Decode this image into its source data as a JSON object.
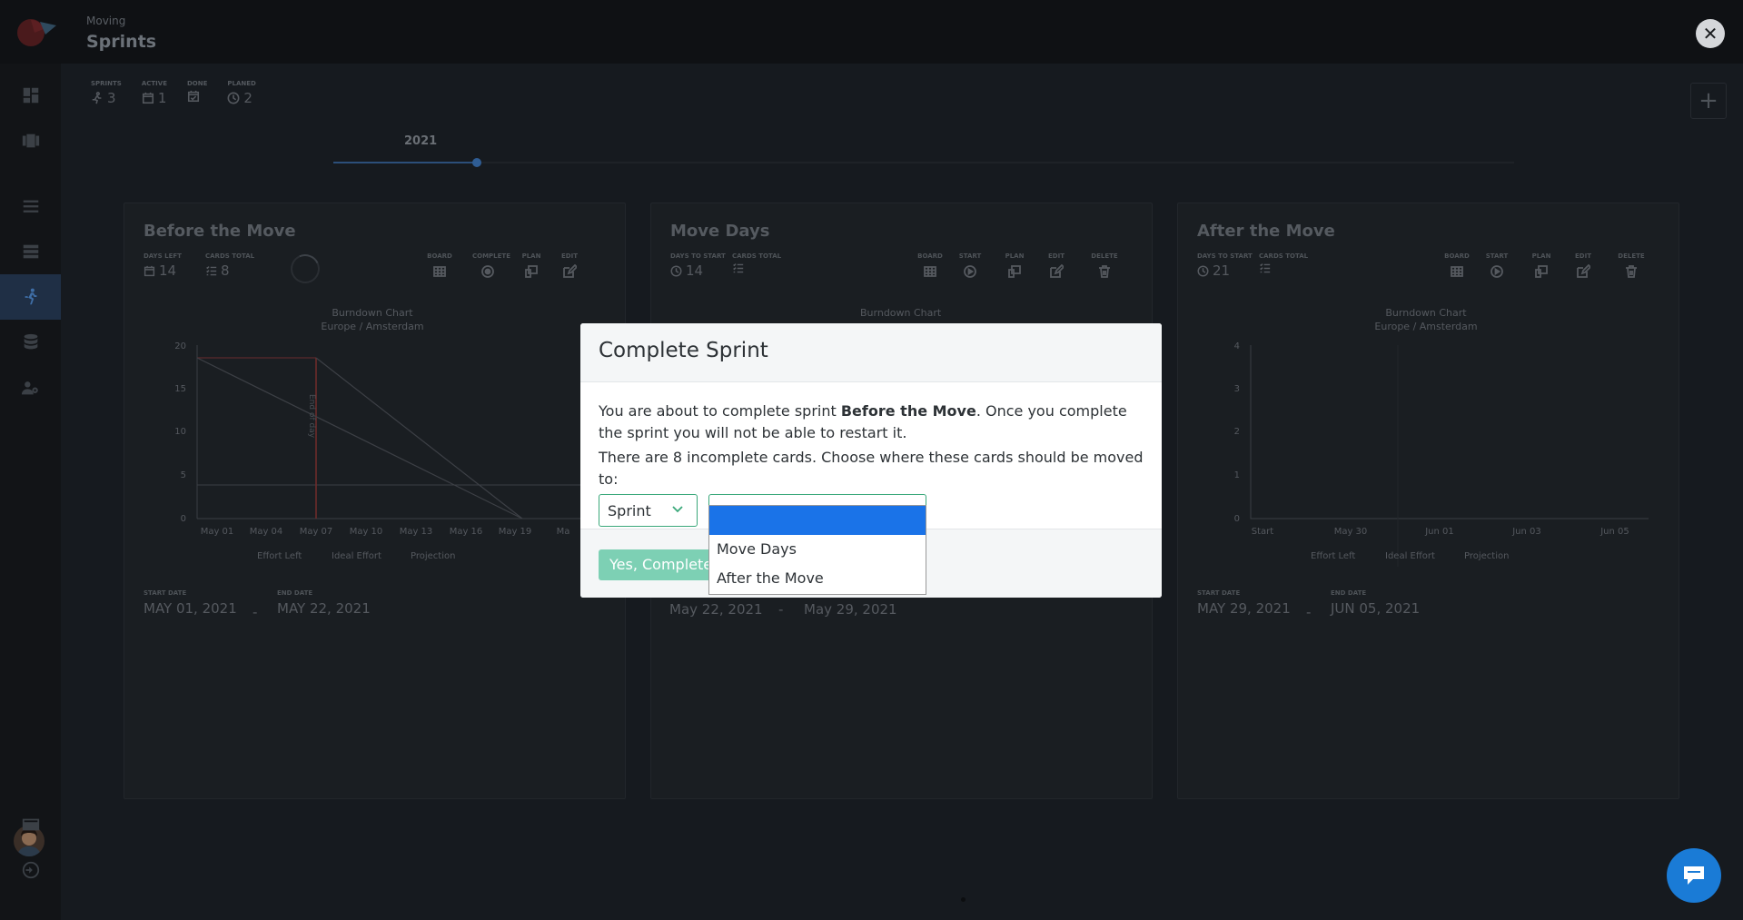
{
  "header": {
    "breadcrumb": "Moving",
    "title": "Sprints"
  },
  "stats": [
    {
      "label": "SPRINTS",
      "value": "3",
      "icon": "running-icon"
    },
    {
      "label": "ACTIVE",
      "value": "1",
      "icon": "calendar-icon"
    },
    {
      "label": "DONE",
      "value": "",
      "icon": "calendar-check-icon"
    },
    {
      "label": "PLANED",
      "value": "2",
      "icon": "clock-icon"
    }
  ],
  "timeline": {
    "year": "2021"
  },
  "sprints": [
    {
      "name": "Before the Move",
      "stat1_label": "DAYS LEFT",
      "stat1_value": "14",
      "stat2_label": "CARDS TOTAL",
      "stat2_value": "8",
      "actions": [
        "BOARD",
        "COMPLETE",
        "PLAN",
        "EDIT"
      ],
      "chart_title": "Burndown Chart",
      "chart_subtitle": "Europe / Amsterdam",
      "x_ticks": [
        "May 01",
        "May 04",
        "May 07",
        "May 10",
        "May 13",
        "May 16",
        "May 19",
        "Ma"
      ],
      "y_ticks": [
        "20",
        "15",
        "10",
        "5",
        "0"
      ],
      "annotation": "End of day",
      "legend": [
        "Effort Left",
        "Ideal Effort",
        "Projection"
      ],
      "start_label": "START DATE",
      "start": "May 01, 2021",
      "end_label": "END DATE",
      "end": "May 22, 2021"
    },
    {
      "name": "Move Days",
      "stat1_label": "DAYS TO START",
      "stat1_value": "14",
      "stat2_label": "CARDS TOTAL",
      "stat2_value": "",
      "actions": [
        "BOARD",
        "START",
        "PLAN",
        "EDIT",
        "DELETE"
      ],
      "chart_title": "Burndown Chart",
      "start": "May 22, 2021",
      "end": "May 29, 2021"
    },
    {
      "name": "After the Move",
      "stat1_label": "DAYS TO START",
      "stat1_value": "21",
      "stat2_label": "CARDS TOTAL",
      "stat2_value": "",
      "actions": [
        "BOARD",
        "START",
        "PLAN",
        "EDIT",
        "DELETE"
      ],
      "chart_title": "Burndown Chart",
      "chart_subtitle": "Europe / Amsterdam",
      "x_ticks": [
        "Start",
        "May 30",
        "Jun 01",
        "Jun 03",
        "Jun 05"
      ],
      "y_ticks": [
        "4",
        "3",
        "2",
        "1",
        "0"
      ],
      "legend": [
        "Effort Left",
        "Ideal Effort",
        "Projection"
      ],
      "start_label": "START DATE",
      "start": "May 29, 2021",
      "end_label": "END DATE",
      "end": "Jun 05, 2021"
    }
  ],
  "modal": {
    "title": "Complete Sprint",
    "line1_pre": "You are about to complete sprint ",
    "line1_bold": "Before the Move",
    "line1_post": ". Once you complete the sprint you will not be able to restart it.",
    "line2": "There are 8 incomplete cards. Choose where these cards should be moved to:",
    "target_type": "Sprint",
    "target_value": "",
    "options": [
      "",
      "Move Days",
      "After the Move"
    ],
    "confirm_label": "Yes, Complete"
  },
  "colors": {
    "accent": "#3aa87a",
    "confirm": "#7dd0b4",
    "selected_option": "#1a73e8",
    "chat": "#1a7bd6"
  }
}
